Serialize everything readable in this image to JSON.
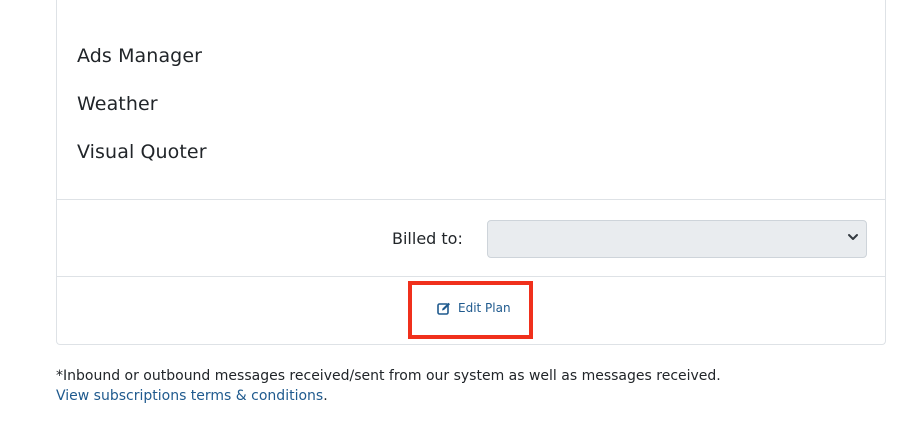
{
  "features": [
    {
      "label": "Ads Manager"
    },
    {
      "label": "Weather"
    },
    {
      "label": "Visual Quoter"
    }
  ],
  "billing": {
    "label": "Billed to:",
    "selected_value": ""
  },
  "actions": {
    "edit_plan_label": "Edit Plan",
    "edit_icon": "edit-icon"
  },
  "footnote": {
    "text": "*Inbound or outbound messages received/sent from our system as well as messages received.",
    "terms_link": "View subscriptions terms & conditions",
    "terms_suffix": "."
  },
  "colors": {
    "link": "#1f5a8e",
    "highlight": "#f0301c",
    "select_bg": "#e9ecef",
    "border": "#dee2e6"
  }
}
